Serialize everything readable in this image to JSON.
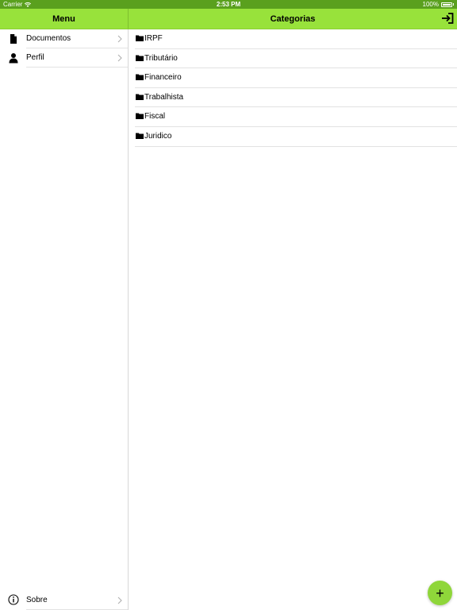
{
  "status_bar": {
    "carrier": "Carrier",
    "time": "2:53 PM",
    "battery": "100%"
  },
  "nav": {
    "menu_title": "Menu",
    "main_title": "Categorias",
    "logout_icon": "logout-icon"
  },
  "sidebar": {
    "items": [
      {
        "label": "Documentos",
        "icon": "document-icon"
      },
      {
        "label": "Perfil",
        "icon": "person-icon"
      }
    ],
    "footer": {
      "label": "Sobre",
      "icon": "info-icon"
    }
  },
  "categories": [
    {
      "label": "IRPF"
    },
    {
      "label": "Tributário"
    },
    {
      "label": "Financeiro"
    },
    {
      "label": "Trabalhista"
    },
    {
      "label": "Fiscal"
    },
    {
      "label": "Juridico"
    }
  ],
  "fab": {
    "label": "+"
  },
  "colors": {
    "status_bar": "#5aa01e",
    "nav_bar": "#98e23b",
    "fab": "#8fd63a"
  }
}
